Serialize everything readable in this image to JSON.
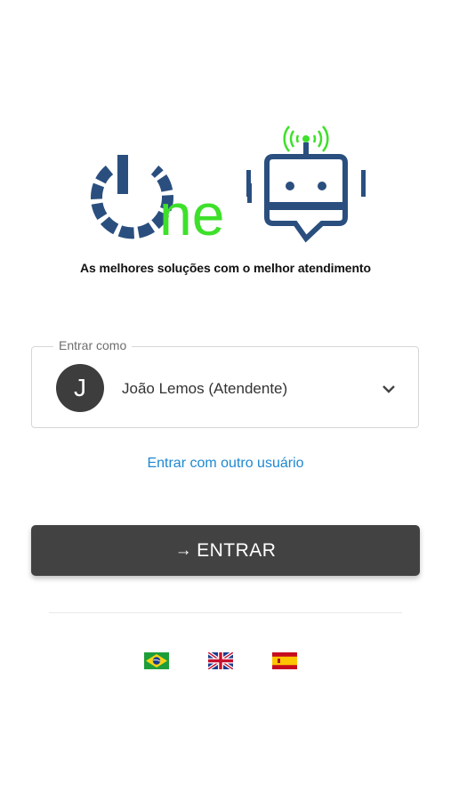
{
  "logo": {
    "text": "ne",
    "tagline": "As melhores soluções com o melhor atendimento",
    "colors": {
      "blue": "#2a4f7f",
      "green": "#3ee02a"
    }
  },
  "login": {
    "legend": "Entrar como",
    "avatar_initial": "J",
    "selected_user": "João Lemos (Atendente)",
    "other_user_link": "Entrar com outro usuário",
    "enter_button": "ENTRAR",
    "enter_icon": "arrow-right-icon"
  },
  "languages": [
    {
      "name": "brazil-flag-icon"
    },
    {
      "name": "uk-flag-icon"
    },
    {
      "name": "spain-flag-icon"
    }
  ],
  "colors": {
    "button_bg": "#424242",
    "link": "#1e88d2",
    "avatar_bg": "#3d3d3d"
  }
}
